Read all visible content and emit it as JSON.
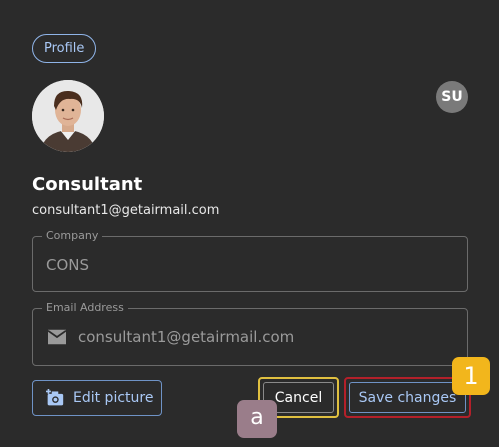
{
  "chip": {
    "label": "Profile"
  },
  "user": {
    "initials": "SU",
    "name": "Consultant",
    "email": "consultant1@getairmail.com"
  },
  "fields": {
    "company": {
      "label": "Company",
      "value": "CONS"
    },
    "email": {
      "label": "Email Address",
      "value": "consultant1@getairmail.com"
    }
  },
  "buttons": {
    "edit_picture": "Edit picture",
    "cancel": "Cancel",
    "save": "Save changes"
  },
  "annotations": {
    "badge_1": "1",
    "badge_a": "a"
  },
  "colors": {
    "background": "#2b2b2b",
    "accent": "#a9c8f5",
    "badge_yellow": "#f2b61c",
    "badge_mauve": "#9a7d8a",
    "highlight_red": "#b3202a",
    "highlight_yellow": "#e0c040"
  },
  "icons": {
    "mail": "mail-icon",
    "camera": "add-photo-icon"
  }
}
